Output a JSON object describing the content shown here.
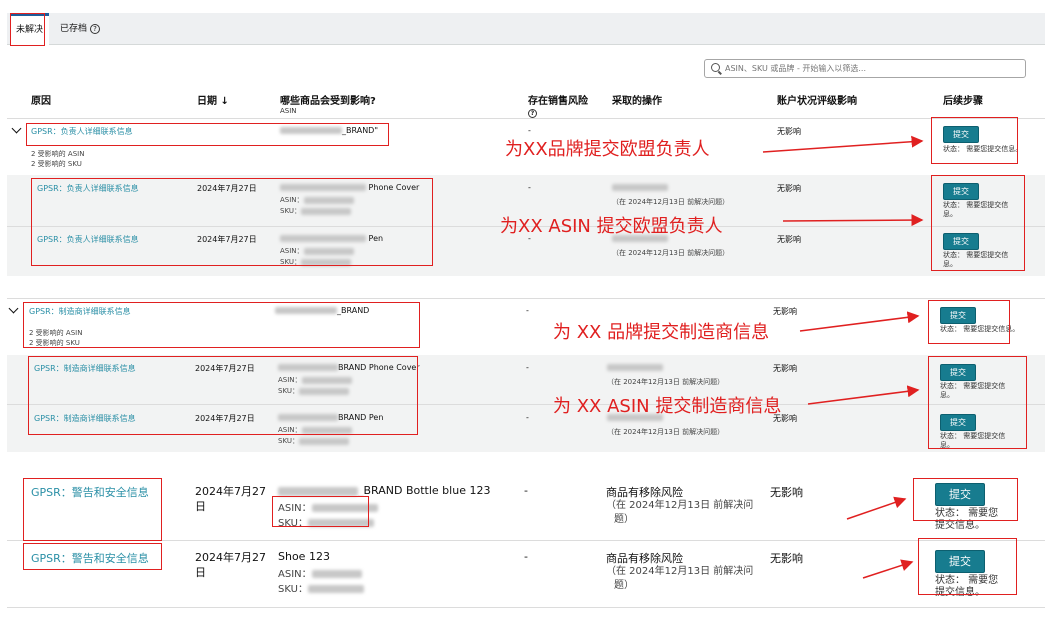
{
  "tabs": [
    {
      "label": "未解决"
    },
    {
      "label": "已存档"
    }
  ],
  "search": {
    "placeholder": "ASIN、SKU 或品牌 - 开始输入以筛选..."
  },
  "columns": {
    "reason": "原因",
    "date": "日期",
    "date_sort": "↓",
    "affected": "哪些商品会受到影响?",
    "affected_sub": "ASIN",
    "risk": "存在销售风险",
    "action": "采取的操作",
    "impact": "账户状况评级影响",
    "next": "后续步骤"
  },
  "groups": [
    {
      "reason": "GPSR：负责人详细联系信息",
      "brand": "_BRAND\"",
      "count_asin": "2 受影响的 ASIN",
      "count_sku": "2 受影响的 SKU",
      "risk": "-",
      "impact": "无影响",
      "button": "提交",
      "status": "状态：",
      "status_text": "需要您提交信息。",
      "items": [
        {
          "reason": "GPSR：负责人详细联系信息",
          "date": "2024年7月27日",
          "product": "Phone Cover",
          "asin": "ASIN：",
          "sku": "SKU：",
          "risk": "-",
          "action_sub": "（在 2024年12月13日 前解决问题）",
          "impact": "无影响",
          "button": "提交",
          "status": "状态：",
          "status_text": "需要您提交信息。"
        },
        {
          "reason": "GPSR：负责人详细联系信息",
          "date": "2024年7月27日",
          "product": "Pen",
          "asin": "ASIN：",
          "sku": "SKU：",
          "risk": "-",
          "action_sub": "（在 2024年12月13日 前解决问题）",
          "impact": "无影响",
          "button": "提交",
          "status": "状态：",
          "status_text": "需要您提交信息。"
        }
      ]
    },
    {
      "reason": "GPSR：制造商详细联系信息",
      "brand": "_BRAND",
      "count_asin": "2 受影响的 ASIN",
      "count_sku": "2 受影响的 SKU",
      "risk": "-",
      "impact": "无影响",
      "button": "提交",
      "status": "状态：",
      "status_text": "需要您提交信息。",
      "items": [
        {
          "reason": "GPSR：制造商详细联系信息",
          "date": "2024年7月27日",
          "product": "BRAND Phone Cover",
          "asin": "ASIN：",
          "sku": "SKU：",
          "risk": "-",
          "action_sub": "（在 2024年12月13日 前解决问题）",
          "impact": "无影响",
          "button": "提交",
          "status": "状态：",
          "status_text": "需要您提交信息。"
        },
        {
          "reason": "GPSR：制造商详细联系信息",
          "date": "2024年7月27日",
          "product": "BRAND Pen",
          "asin": "ASIN：",
          "sku": "SKU：",
          "risk": "-",
          "action_sub": "（在 2024年12月13日 前解决问题）",
          "impact": "无影响",
          "button": "提交",
          "status": "状态：",
          "status_text": "需要您提交信息。"
        }
      ]
    }
  ],
  "rows": [
    {
      "reason": "GPSR：警告和安全信息",
      "date_line1": "2024年7月27",
      "date_line2": "日",
      "product": "_BRAND Bottle blue 123",
      "asin": "ASIN：",
      "sku": "SKU：",
      "risk": "-",
      "action": "商品有移除风险",
      "action_sub1": "（在 2024年12月13日 前解决问",
      "action_sub2": "题）",
      "impact": "无影响",
      "button": "提交",
      "status1": "状态：  需要您",
      "status2": "提交信息。"
    },
    {
      "reason": "GPSR：警告和安全信息",
      "date_line1": "2024年7月27",
      "date_line2": "日",
      "product": "Shoe 123",
      "asin": "ASIN：",
      "sku": "SKU：",
      "risk": "-",
      "action": "商品有移除风险",
      "action_sub1": "（在 2024年12月13日 前解决问",
      "action_sub2": "题）",
      "impact": "无影响",
      "button": "提交",
      "status1": "状态：  需要您",
      "status2": "提交信息。"
    }
  ],
  "annotations": [
    "为XX品牌提交欧盟负责人",
    "为XX ASIN 提交欧盟负责人",
    "为 XX 品牌提交制造商信息",
    "为 XX ASIN 提交制造商信息"
  ],
  "colors": {
    "accent": "#177c8f",
    "link": "#2a8fa6",
    "annotation": "#e02020",
    "tab_indicator": "#1f5c99"
  }
}
